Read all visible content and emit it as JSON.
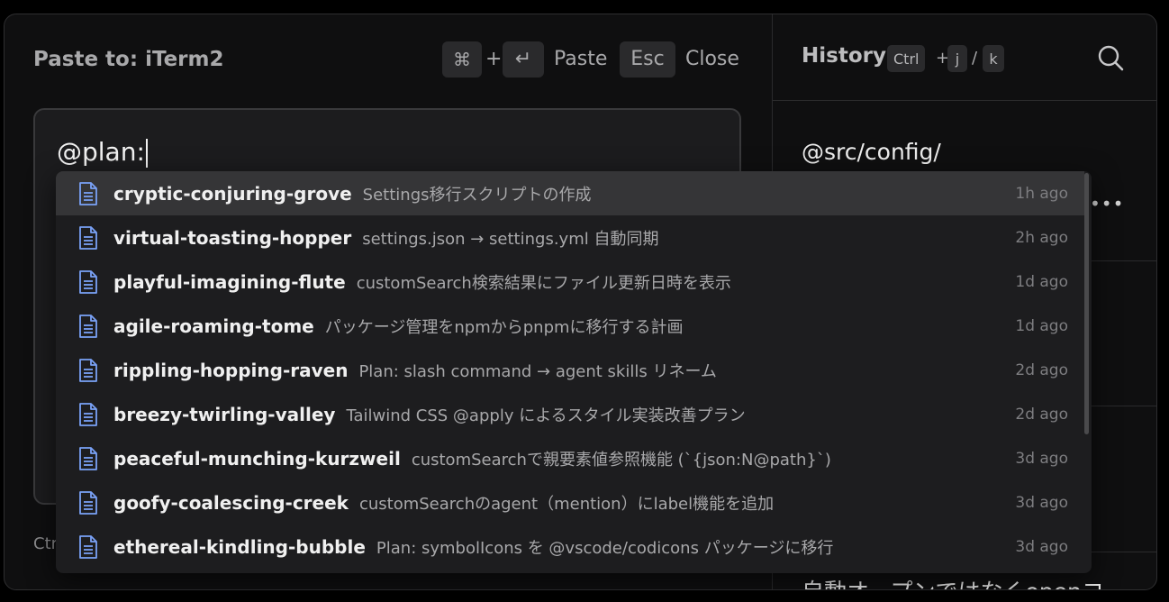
{
  "paste": {
    "label": "Paste to: ",
    "target": "iTerm2",
    "cmd_key": "⌘",
    "plus": "+",
    "enter_key": "↵",
    "paste_label": "Paste",
    "esc_key": "Esc",
    "close_label": "Close"
  },
  "editor": {
    "value": "@plan:"
  },
  "hint": {
    "text": "Ctr"
  },
  "history": {
    "title": "History",
    "key_ctrl": "Ctrl",
    "plus": "+",
    "key_j": "j",
    "slash": "/",
    "key_k": "k",
    "items": [
      {
        "text": "@src/config/"
      },
      {
        "text": "自動オープンではなくopenコ"
      }
    ]
  },
  "dropdown": {
    "items": [
      {
        "name": "cryptic-conjuring-grove",
        "desc": "Settings移行スクリプトの作成",
        "time": "1h ago"
      },
      {
        "name": "virtual-toasting-hopper",
        "desc": "settings.json → settings.yml 自動同期",
        "time": "2h ago"
      },
      {
        "name": "playful-imagining-flute",
        "desc": "customSearch検索結果にファイル更新日時を表示",
        "time": "1d ago"
      },
      {
        "name": "agile-roaming-tome",
        "desc": "パッケージ管理をnpmからpnpmに移行する計画",
        "time": "1d ago"
      },
      {
        "name": "rippling-hopping-raven",
        "desc": "Plan: slash command → agent skills リネーム",
        "time": "2d ago"
      },
      {
        "name": "breezy-twirling-valley",
        "desc": "Tailwind CSS @apply によるスタイル実装改善プラン",
        "time": "2d ago"
      },
      {
        "name": "peaceful-munching-kurzweil",
        "desc": "customSearchで親要素値参照機能 (`{json:N@path}`)",
        "time": "3d ago"
      },
      {
        "name": "goofy-coalescing-creek",
        "desc": "customSearchのagent（mention）にlabel機能を追加",
        "time": "3d ago"
      },
      {
        "name": "ethereal-kindling-bubble",
        "desc": "Plan: symbolIcons を @vscode/codicons パッケージに移行",
        "time": "3d ago"
      }
    ]
  },
  "colors": {
    "background": "#0f0f10",
    "selected_row": "#353537",
    "file_icon": "#7aa2f7"
  }
}
